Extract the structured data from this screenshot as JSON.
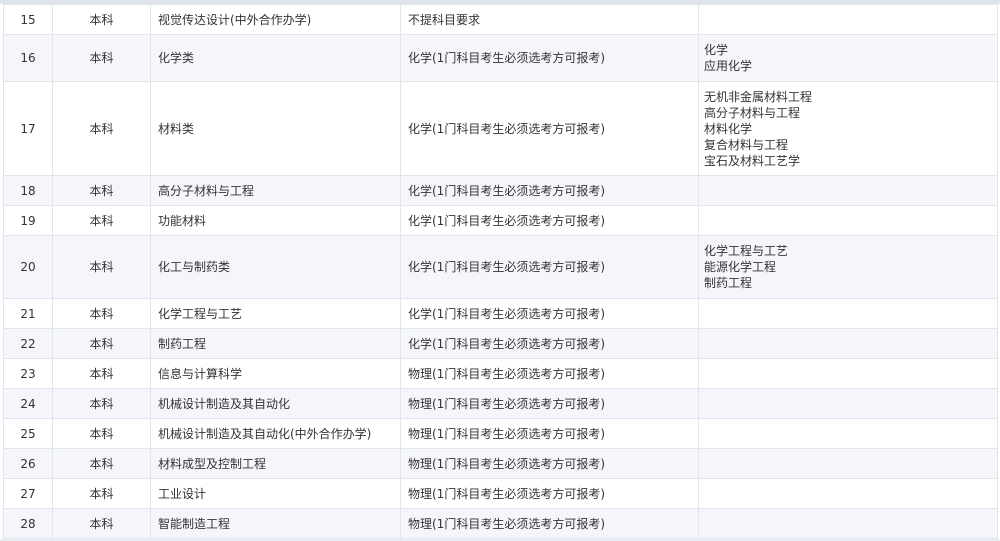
{
  "table": {
    "rows": [
      {
        "index": "15",
        "level": "本科",
        "major": "视觉传达设计(中外合作办学)",
        "subject": "不提科目要求",
        "includes": []
      },
      {
        "index": "16",
        "level": "本科",
        "major": "化学类",
        "subject": "化学(1门科目考生必须选考方可报考)",
        "includes": [
          "化学",
          "应用化学"
        ]
      },
      {
        "index": "17",
        "level": "本科",
        "major": "材料类",
        "subject": "化学(1门科目考生必须选考方可报考)",
        "includes": [
          "无机非金属材料工程",
          "高分子材料与工程",
          "材料化学",
          "复合材料与工程",
          "宝石及材料工艺学"
        ]
      },
      {
        "index": "18",
        "level": "本科",
        "major": "高分子材料与工程",
        "subject": "化学(1门科目考生必须选考方可报考)",
        "includes": []
      },
      {
        "index": "19",
        "level": "本科",
        "major": "功能材料",
        "subject": "化学(1门科目考生必须选考方可报考)",
        "includes": []
      },
      {
        "index": "20",
        "level": "本科",
        "major": "化工与制药类",
        "subject": "化学(1门科目考生必须选考方可报考)",
        "includes": [
          "化学工程与工艺",
          "能源化学工程",
          "制药工程"
        ]
      },
      {
        "index": "21",
        "level": "本科",
        "major": "化学工程与工艺",
        "subject": "化学(1门科目考生必须选考方可报考)",
        "includes": []
      },
      {
        "index": "22",
        "level": "本科",
        "major": "制药工程",
        "subject": "化学(1门科目考生必须选考方可报考)",
        "includes": []
      },
      {
        "index": "23",
        "level": "本科",
        "major": "信息与计算科学",
        "subject": "物理(1门科目考生必须选考方可报考)",
        "includes": []
      },
      {
        "index": "24",
        "level": "本科",
        "major": "机械设计制造及其自动化",
        "subject": "物理(1门科目考生必须选考方可报考)",
        "includes": []
      },
      {
        "index": "25",
        "level": "本科",
        "major": "机械设计制造及其自动化(中外合作办学)",
        "subject": "物理(1门科目考生必须选考方可报考)",
        "includes": []
      },
      {
        "index": "26",
        "level": "本科",
        "major": "材料成型及控制工程",
        "subject": "物理(1门科目考生必须选考方可报考)",
        "includes": []
      },
      {
        "index": "27",
        "level": "本科",
        "major": "工业设计",
        "subject": "物理(1门科目考生必须选考方可报考)",
        "includes": []
      },
      {
        "index": "28",
        "level": "本科",
        "major": "智能制造工程",
        "subject": "物理(1门科目考生必须选考方可报考)",
        "includes": []
      }
    ]
  }
}
